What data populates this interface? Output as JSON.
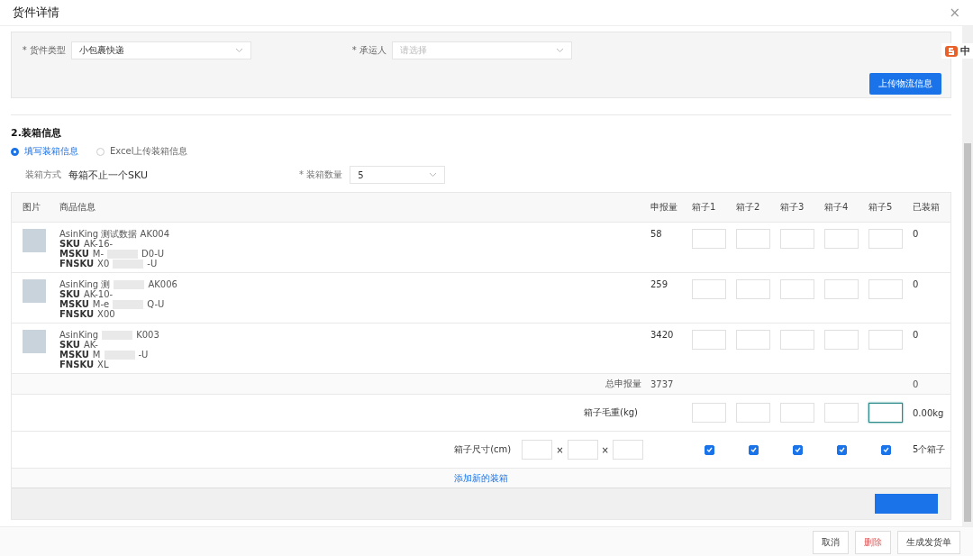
{
  "window": {
    "title": "货件详情",
    "close": "×"
  },
  "ime": {
    "label": "中"
  },
  "shipment_form": {
    "fields": [
      {
        "label": "* 货件类型",
        "value": "小包裹快递"
      },
      {
        "label": "* 承运人",
        "placeholder": "请选择"
      }
    ],
    "upload_button": "上传物流信息"
  },
  "packing": {
    "title": "2.装箱信息",
    "modes": [
      {
        "label": "填写装箱信息",
        "selected": true
      },
      {
        "label": "Excel上传装箱信息",
        "selected": false
      }
    ],
    "method_label": "装箱方式",
    "method_value": "每箱不止一个SKU",
    "box_count_label": "* 装箱数量",
    "box_count_value": "5"
  },
  "table": {
    "columns": [
      "图片",
      "商品信息",
      "申报量",
      "箱子1",
      "箱子2",
      "箱子3",
      "箱子4",
      "箱子5",
      "已装箱"
    ],
    "rows": [
      {
        "name": [
          "AsinKing 测试数据 AK004"
        ],
        "sku_label": "SKU",
        "sku": [
          "AK-16-"
        ],
        "msku_label": "MSKU",
        "msku": [
          "M-",
          "D0-U"
        ],
        "fnsku_label": "FNSKU",
        "fnsku": [
          "X0",
          "-U"
        ],
        "declared": "58",
        "packed": "0"
      },
      {
        "name": [
          "AsinKing 测",
          "AK006"
        ],
        "sku_label": "SKU",
        "sku": [
          "AK-10-"
        ],
        "msku_label": "MSKU",
        "msku": [
          "M-e",
          "Q-U"
        ],
        "fnsku_label": "FNSKU",
        "fnsku": [
          "X00"
        ],
        "declared": "259",
        "packed": "0"
      },
      {
        "name": [
          "AsinKing",
          "K003"
        ],
        "sku_label": "SKU",
        "sku": [
          "AK-"
        ],
        "msku_label": "MSKU",
        "msku": [
          "M",
          "-U"
        ],
        "fnsku_label": "FNSKU",
        "fnsku": [
          "XL"
        ],
        "declared": "3420",
        "packed": "0"
      }
    ],
    "total_label": "总申报量",
    "total_value": "3737",
    "total_packed": "0",
    "weight_label": "箱子毛重(kg)",
    "weights": [
      {
        "focused": false
      },
      {
        "focused": false
      },
      {
        "focused": false
      },
      {
        "focused": false
      },
      {
        "focused": true
      }
    ],
    "weight_total": "0.00kg",
    "size_label": "箱子尺寸(cm)",
    "size_sep": [
      "×",
      "×"
    ],
    "box_checks": [
      {
        "checked": true
      },
      {
        "checked": true
      },
      {
        "checked": true
      },
      {
        "checked": true
      },
      {
        "checked": true
      }
    ],
    "box_total": "5个箱子",
    "add_link": "添加新的装箱"
  },
  "footer": {
    "buttons": [
      {
        "label": "取消",
        "kind": "default"
      },
      {
        "label": "删除",
        "kind": "danger"
      },
      {
        "label": "生成发货单",
        "kind": "default"
      }
    ]
  }
}
